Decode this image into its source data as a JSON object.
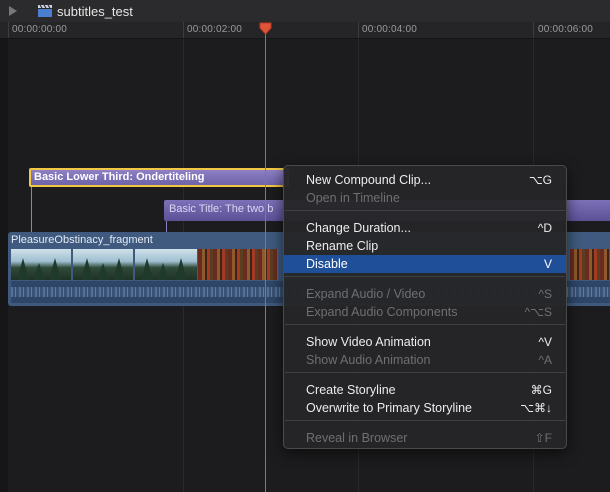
{
  "project": {
    "title": "subtitles_test"
  },
  "ruler": {
    "timecodes": [
      "00:00:00:00",
      "00:00:02:00",
      "00:00:04:00",
      "00:00:06:00"
    ]
  },
  "clips": {
    "lower_third": "Basic Lower Third: Ondertiteling",
    "basic_title": "Basic Title: The two b",
    "video": "PleasureObstinacy_fragment"
  },
  "menu": {
    "items": [
      {
        "label": "New Compound Clip...",
        "shortcut": "⌥G",
        "enabled": true
      },
      {
        "label": "Open in Timeline",
        "shortcut": "",
        "enabled": false
      },
      {
        "label": "Change Duration...",
        "shortcut": "^D",
        "enabled": true
      },
      {
        "label": "Rename Clip",
        "shortcut": "",
        "enabled": true
      },
      {
        "label": "Disable",
        "shortcut": "V",
        "enabled": true,
        "selected": true
      },
      {
        "label": "Expand Audio / Video",
        "shortcut": "^S",
        "enabled": false
      },
      {
        "label": "Expand Audio Components",
        "shortcut": "^⌥S",
        "enabled": false
      },
      {
        "label": "Show Video Animation",
        "shortcut": "^V",
        "enabled": true
      },
      {
        "label": "Show Audio Animation",
        "shortcut": "^A",
        "enabled": false
      },
      {
        "label": "Create Storyline",
        "shortcut": "⌘G",
        "enabled": true
      },
      {
        "label": "Overwrite to Primary Storyline",
        "shortcut": "⌥⌘↓",
        "enabled": true
      },
      {
        "label": "Reveal in Browser",
        "shortcut": "⇧F",
        "enabled": false
      }
    ]
  },
  "colors": {
    "playhead": "#e0553a",
    "selection": "#1f4f98",
    "title_clip": "#7c70b8",
    "selected_clip_border": "#f2c744",
    "video_clip": "#3f5a7e"
  },
  "icons": {
    "play": "play-icon",
    "project": "clapperboard-icon",
    "playhead": "playhead-icon"
  }
}
